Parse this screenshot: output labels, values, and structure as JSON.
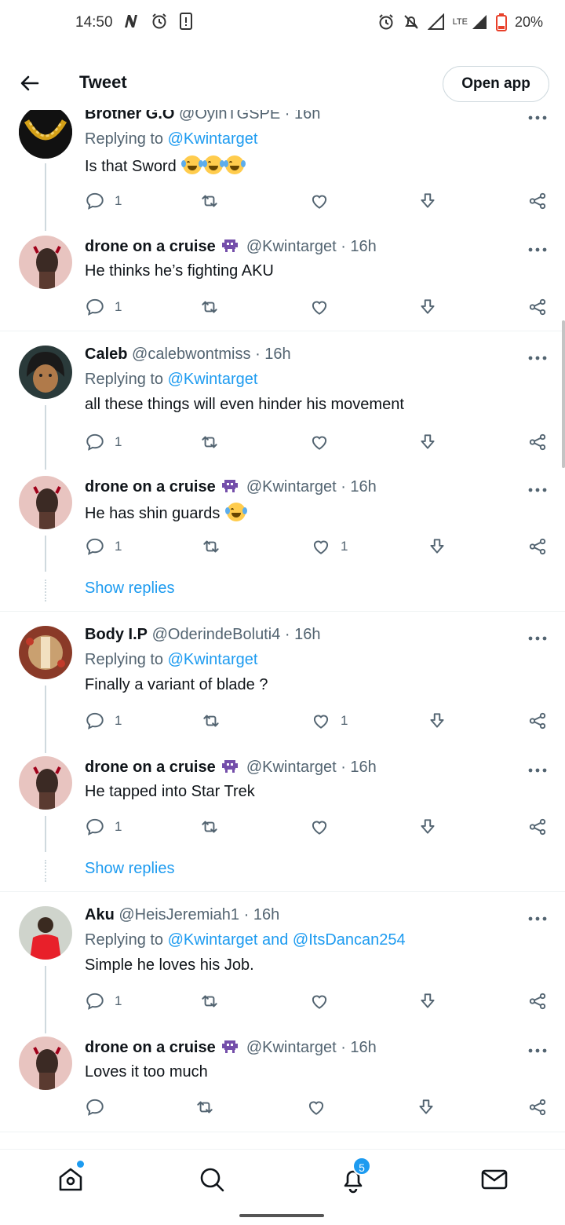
{
  "status_bar": {
    "time": "14:50",
    "battery": "20%",
    "network": "LTE",
    "icons_left": [
      "n-icon",
      "alarm-icon",
      "screen-icon"
    ],
    "icons_right": [
      "alarm-icon",
      "mute-icon",
      "signal-icon",
      "lte-signal-icon",
      "battery-icon"
    ]
  },
  "header": {
    "title": "Tweet",
    "open_app": "Open app"
  },
  "colors": {
    "accent": "#1d9bf0",
    "text": "#0f1419",
    "secondary": "#536471",
    "divider": "#eff3f4"
  },
  "tweets": [
    {
      "name": "Brother G.O",
      "handle": "@OyinTGSPE",
      "time": "· 16h",
      "replying_prefix": "Replying to",
      "replying_to": "@Kwintarget",
      "text": "Is that Sword",
      "emojis": 3,
      "replies": "1",
      "likes": ""
    },
    {
      "name": "drone on a cruise",
      "handle": "@Kwintarget",
      "time": "· 16h",
      "text": "He thinks he’s fighting AKU",
      "replies": "1",
      "likes": ""
    },
    {
      "name": "Caleb",
      "handle": "@calebwontmiss",
      "time": "· 16h",
      "replying_prefix": "Replying to",
      "replying_to": "@Kwintarget",
      "text": "all these things will even hinder his movement",
      "replies": "1",
      "likes": ""
    },
    {
      "name": "drone on a cruise",
      "handle": "@Kwintarget",
      "time": "· 16h",
      "text": "He has shin guards",
      "emojis": 1,
      "replies": "1",
      "likes": "1"
    },
    {
      "name": "Body I.P",
      "handle": "@OderindeBoluti4",
      "time": "· 16h",
      "replying_prefix": "Replying to",
      "replying_to": "@Kwintarget",
      "text": "Finally a variant of blade ?",
      "replies": "1",
      "likes": "1"
    },
    {
      "name": "drone on a cruise",
      "handle": "@Kwintarget",
      "time": "· 16h",
      "text": "He tapped into Star Trek",
      "replies": "1",
      "likes": ""
    },
    {
      "name": "Aku",
      "handle": "@HeisJeremiah1",
      "time": "· 16h",
      "replying_prefix": "Replying to",
      "replying_to": "@Kwintarget and @ItsDancan254",
      "text": "Simple he loves his Job.",
      "replies": "1",
      "likes": ""
    },
    {
      "name": "drone on a cruise",
      "handle": "@Kwintarget",
      "time": "· 16h",
      "text": "Loves it too much",
      "replies": "",
      "likes": ""
    }
  ],
  "show_replies": "Show replies",
  "bottom_nav": {
    "items": [
      "home-icon",
      "search-icon",
      "notifications-icon",
      "messages-icon"
    ],
    "notification_count": "5"
  }
}
